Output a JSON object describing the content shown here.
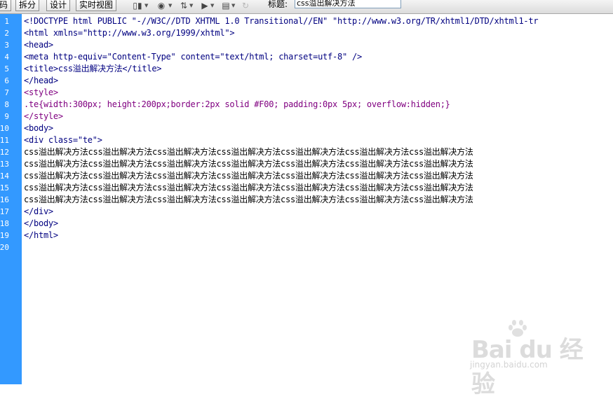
{
  "toolbar": {
    "view_buttons": [
      "码",
      "拆分",
      "设计",
      "实时视图"
    ],
    "icons": [
      "multiscreen-icon",
      "globe-icon",
      "file-management-icon",
      "visual-aids-icon",
      "check-page-icon",
      "refresh-icon"
    ],
    "title_label": "标题:",
    "title_value": "css溢出解决方法"
  },
  "editor": {
    "line_numbers": [
      "1",
      "2",
      "3",
      "4",
      "5",
      "6",
      "7",
      "8",
      "9",
      "10",
      "11",
      "12",
      "13",
      "14",
      "15",
      "16",
      "17",
      "18",
      "19",
      "20"
    ],
    "lines": [
      {
        "style": "tag",
        "text": "<!DOCTYPE html PUBLIC \"-//W3C//DTD XHTML 1.0 Transitional//EN\" \"http://www.w3.org/TR/xhtml1/DTD/xhtml1-tr"
      },
      {
        "style": "tag",
        "text": "<html xmlns=\"http://www.w3.org/1999/xhtml\">"
      },
      {
        "style": "tag",
        "text": "<head>"
      },
      {
        "style": "tag",
        "text": "<meta http-equiv=\"Content-Type\" content=\"text/html; charset=utf-8\" />"
      },
      {
        "style": "tag",
        "text": "<title>css溢出解决方法</title>"
      },
      {
        "style": "tag",
        "text": "</head>"
      },
      {
        "style": "css",
        "text": "<style>"
      },
      {
        "style": "cssdef",
        "text": ".te{width:300px; height:200px;border:2px solid #F00; padding:0px 5px; overflow:hidden;}"
      },
      {
        "style": "css",
        "text": "</style>"
      },
      {
        "style": "tag",
        "text": "<body>"
      },
      {
        "style": "tag",
        "text": "<div class=\"te\">"
      },
      {
        "style": "txt",
        "text": "css溢出解决方法css溢出解决方法css溢出解决方法css溢出解决方法css溢出解决方法css溢出解决方法css溢出解决方法"
      },
      {
        "style": "txt",
        "text": "css溢出解决方法css溢出解决方法css溢出解决方法css溢出解决方法css溢出解决方法css溢出解决方法css溢出解决方法"
      },
      {
        "style": "txt",
        "text": "css溢出解决方法css溢出解决方法css溢出解决方法css溢出解决方法css溢出解决方法css溢出解决方法css溢出解决方法"
      },
      {
        "style": "txt",
        "text": "css溢出解决方法css溢出解决方法css溢出解决方法css溢出解决方法css溢出解决方法css溢出解决方法css溢出解决方法"
      },
      {
        "style": "txt",
        "text": "css溢出解决方法css溢出解决方法css溢出解决方法css溢出解决方法css溢出解决方法css溢出解决方法css溢出解决方法"
      },
      {
        "style": "tag",
        "text": "</div>"
      },
      {
        "style": "tag",
        "text": "</body>"
      },
      {
        "style": "tag",
        "text": "</html>"
      },
      {
        "style": "txt",
        "text": ""
      }
    ]
  },
  "watermark": {
    "text": "Bai du 经验",
    "sub": "jingyan.baidu.com"
  },
  "colors": {
    "gutter": "#3399ff",
    "tag": "#000080",
    "css": "#800080",
    "text": "#000000"
  }
}
